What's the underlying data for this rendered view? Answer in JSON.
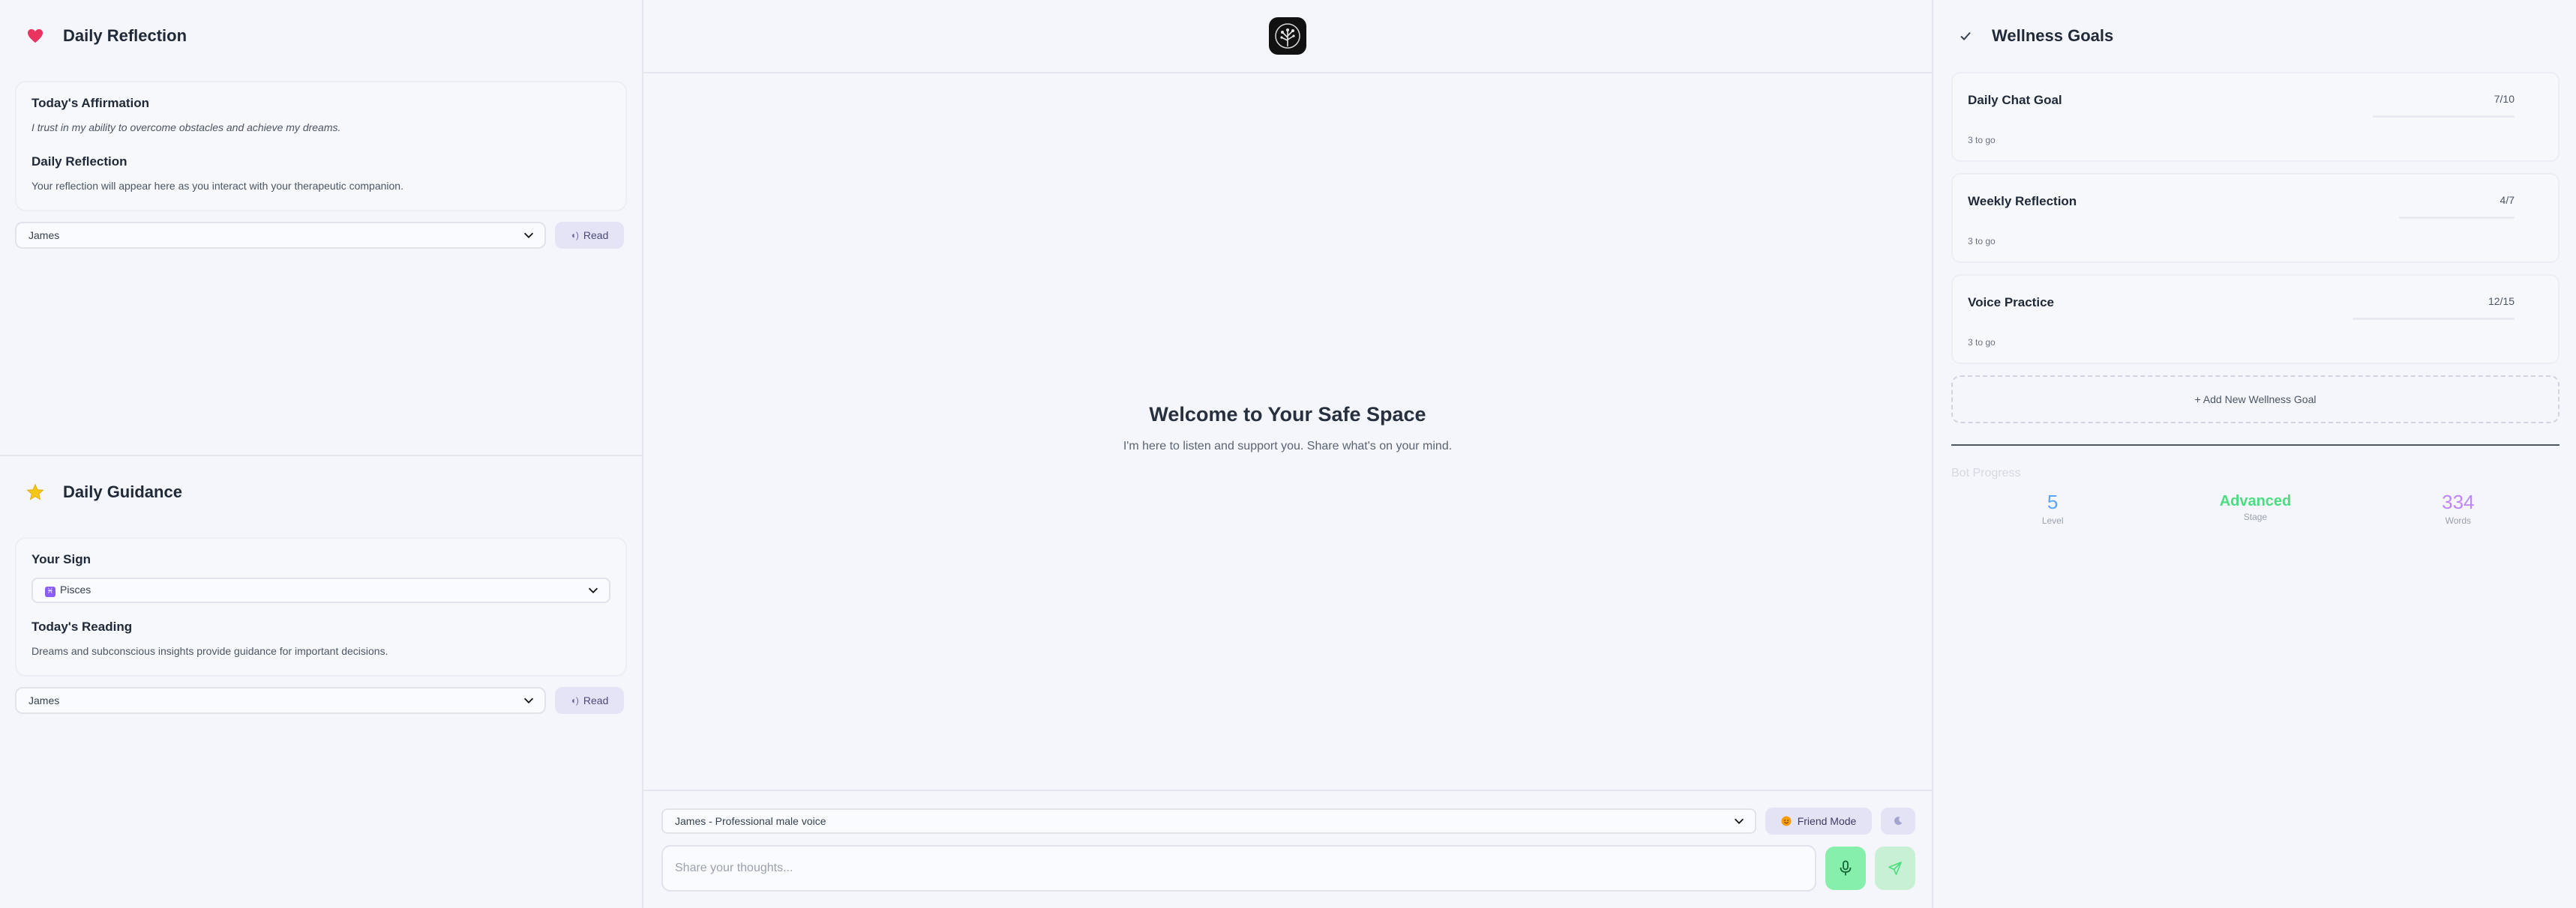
{
  "reflection": {
    "title": "Daily Reflection",
    "affirmation_heading": "Today's Affirmation",
    "affirmation_text": "I trust in my ability to overcome obstacles and achieve my dreams.",
    "reflection_heading": "Daily Reflection",
    "reflection_text": "Your reflection will appear here as you interact with your therapeutic companion.",
    "voice_selected": "James",
    "read_label": "Read"
  },
  "guidance": {
    "title": "Daily Guidance",
    "sign_heading": "Your Sign",
    "sign_selected": "Pisces",
    "sign_glyph": "♓",
    "reading_heading": "Today's Reading",
    "reading_text": "Dreams and subconscious insights provide guidance for important decisions.",
    "voice_selected": "James",
    "read_label": "Read"
  },
  "chat": {
    "welcome_title": "Welcome to Your Safe Space",
    "welcome_subtitle": "I'm here to listen and support you. Share what's on your mind.",
    "voice_selected": "James - Professional male voice",
    "mode_label": "Friend Mode",
    "input_placeholder": "Share your thoughts..."
  },
  "goals": {
    "title": "Wellness Goals",
    "items": [
      {
        "name": "Daily Chat Goal",
        "count": "7/10",
        "remaining": "3 to go",
        "progress": 0.7
      },
      {
        "name": "Weekly Reflection",
        "count": "4/7",
        "remaining": "3 to go",
        "progress": 0.57
      },
      {
        "name": "Voice Practice",
        "count": "12/15",
        "remaining": "3 to go",
        "progress": 0.8
      }
    ],
    "add_label": "+ Add New Wellness Goal"
  },
  "bot_progress": {
    "title": "Bot Progress",
    "level_value": "5",
    "level_label": "Level",
    "stage_value": "Advanced",
    "stage_label": "Stage",
    "words_value": "334",
    "words_label": "Words"
  },
  "colors": {
    "level": "#60a5fa",
    "stage": "#4ade80",
    "words": "#c084fc",
    "mic_button": "#86efac",
    "send_button": "#c7f0d4"
  }
}
